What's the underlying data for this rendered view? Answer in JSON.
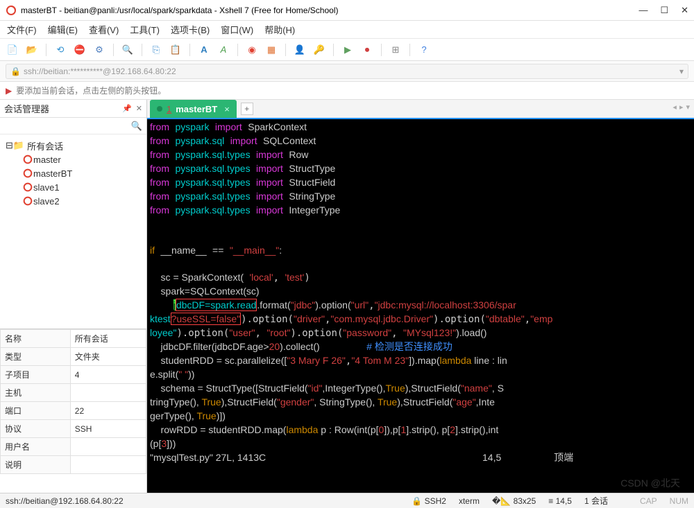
{
  "window": {
    "title": "masterBT - beitian@panli:/usr/local/spark/sparkdata - Xshell 7 (Free for Home/School)"
  },
  "menu": {
    "file": "文件(F)",
    "edit": "编辑(E)",
    "view": "查看(V)",
    "tools": "工具(T)",
    "tabs": "选项卡(B)",
    "window": "窗口(W)",
    "help": "帮助(H)"
  },
  "address": "ssh://beitian:**********@192.168.64.80:22",
  "hint": "要添加当前会话，点击左侧的箭头按钮。",
  "sidepanel": {
    "title": "会话管理器",
    "root": "所有会话",
    "sessions": [
      "master",
      "masterBT",
      "slave1",
      "slave2"
    ]
  },
  "props": [
    {
      "k": "名称",
      "v": "所有会话"
    },
    {
      "k": "类型",
      "v": "文件夹"
    },
    {
      "k": "子项目",
      "v": "4"
    },
    {
      "k": "主机",
      "v": ""
    },
    {
      "k": "端口",
      "v": "22"
    },
    {
      "k": "协议",
      "v": "SSH"
    },
    {
      "k": "用户名",
      "v": ""
    },
    {
      "k": "说明",
      "v": ""
    }
  ],
  "tab": {
    "index": "1",
    "name": "masterBT"
  },
  "code": {
    "imports": [
      {
        "mod": "pyspark",
        "name": "SparkContext"
      },
      {
        "mod": "pyspark.sql",
        "name": "SQLContext"
      },
      {
        "mod": "pyspark.sql.types",
        "name": "Row"
      },
      {
        "mod": "pyspark.sql.types",
        "name": "StructType"
      },
      {
        "mod": "pyspark.sql.types",
        "name": "StructField"
      },
      {
        "mod": "pyspark.sql.types",
        "name": "StringType"
      },
      {
        "mod": "pyspark.sql.types",
        "name": "IntegerType"
      }
    ],
    "ifline": {
      "kw": "if",
      "var": "__name__",
      "eq": "==",
      "val": "\"__main__\"",
      "colon": ":"
    },
    "sc_line": "    sc = SparkContext(",
    "sc_args": [
      "'local'",
      "'test'"
    ],
    "sparkctx": "    spark=SQLContext(sc)",
    "jdbc_pre": "dbcDF=spark.read",
    "jdbc_fmt": ".format(",
    "jdbc_fmt_v": "\"jdbc\"",
    "jdbc_opt": ").option(",
    "url_k": "\"url\"",
    "url_v": "\"jdbc:mysql://localhost:3306/spar",
    "ktest": "ktest",
    "usessl": "?useSSL=false\"",
    "drv_k": "\"driver\"",
    "drv_v": "\"com.mysql.jdbc.Driver\"",
    "dbt_k": "\"dbtable\"",
    "dbt_v": "\"emp",
    "loyee": "loyee\"",
    "usr_k": "\"user\"",
    "usr_v": "\"root\"",
    "pwd_k": "\"password\"",
    "pwd_v": "\"MYsql123!\"",
    "load": ").load()",
    "filter_pre": "    jdbcDF.filter(jdbcDF.age>",
    "filter_n": "20",
    "filter_post": ").collect()",
    "filter_cmt": "# 检测是否连接成功",
    "rdd_pre": "    studentRDD = sc.parallelize([",
    "rdd_s1": "\"3 Mary F 26\"",
    "rdd_s2": "\"4 Tom M 23\"",
    "rdd_post": "]).map(",
    "lam": "lambda",
    "rdd_lam": " line : lin",
    "split_line": "e.split(",
    "split_arg": "\" \"",
    "split_end": "))",
    "schema_pre": "    schema = StructType([StructField(",
    "id": "\"id\"",
    "int_t": ",IntegerType(),",
    "true": "True",
    "sf": "),StructField(",
    "name_s": "\"name\"",
    "s_end": ", S",
    "string_line": "tringType(), ",
    "gender": "\"gender\"",
    "str_t": ", StringType(), ",
    "age": "\"age\"",
    "inte": ",Inte",
    "gertype": "gerType(), ",
    "close_sq": ")])",
    "row_pre": "    rowRDD = studentRDD.map(",
    "row_lam": " p : Row(int(p[",
    "n0": "0",
    "n1": "1",
    "n2": "2",
    "n3": "3",
    "row_mid": "]),p[",
    "strip": "].strip(), p[",
    "row_end": "].strip(),int",
    "row_last": "(p[",
    "row_close": "]))",
    "filestat": "\"mysqlTest.py\" 27L, 1413C",
    "pos": "14,5",
    "top": "顶端"
  },
  "status": {
    "path": "ssh://beitian@192.168.64.80:22",
    "proto": "SSH2",
    "term": "xterm",
    "size": "83x25",
    "cursor": "14,5",
    "sess": "1 会话",
    "cap": "CAP",
    "num": "NUM"
  }
}
